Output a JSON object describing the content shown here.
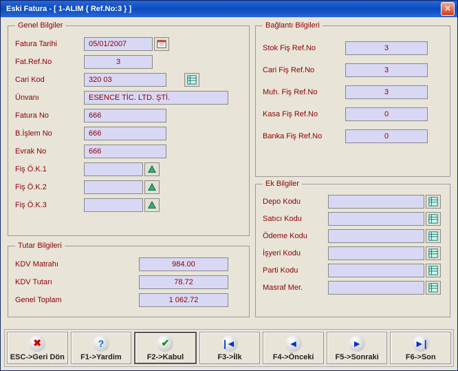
{
  "window": {
    "title": "Eski Fatura - [ 1-ALIM { Ref.No:3 } ]"
  },
  "genel": {
    "legend": "Genel Bilgiler",
    "fatura_tarihi_label": "Fatura Tarihi",
    "fatura_tarihi": "05/01/2007",
    "fat_refno_label": "Fat.Ref.No",
    "fat_refno": "3",
    "cari_kod_label": "Cari Kod",
    "cari_kod": "320 03",
    "unvani_label": "Ünvanı",
    "unvani": "ESENCE TİC. LTD. ŞTİ.",
    "fatura_no_label": "Fatura No",
    "fatura_no": "666",
    "bislem_no_label": "B.İşlem No",
    "bislem_no": "666",
    "evrak_no_label": "Evrak No",
    "evrak_no": "666",
    "fis_ok1_label": "Fiş Ö.K.1",
    "fis_ok1": "",
    "fis_ok2_label": "Fiş Ö.K.2",
    "fis_ok2": "",
    "fis_ok3_label": "Fiş Ö.K.3",
    "fis_ok3": ""
  },
  "baglanti": {
    "legend": "Bağlantı Bilgileri",
    "stok_label": "Stok Fiş Ref.No",
    "stok": "3",
    "cari_label": "Cari Fiş Ref.No",
    "cari": "3",
    "muh_label": "Muh. Fiş Ref.No",
    "muh": "3",
    "kasa_label": "Kasa Fiş Ref.No",
    "kasa": "0",
    "banka_label": "Banka Fiş Ref.No",
    "banka": "0"
  },
  "ek": {
    "legend": "Ek Bilgiler",
    "depo_label": "Depo Kodu",
    "depo": "",
    "satici_label": "Satıcı Kodu",
    "satici": "",
    "odeme_label": "Ödeme Kodu",
    "odeme": "",
    "isyeri_label": "İşyeri Kodu",
    "isyeri": "",
    "parti_label": "Parti Kodu",
    "parti": "",
    "masraf_label": "Masraf Mer.",
    "masraf": ""
  },
  "tutar": {
    "legend": "Tutar Bilgileri",
    "kdv_matrahi_label": "KDV Matrahı",
    "kdv_matrahi": "984.00",
    "kdv_tutari_label": "KDV Tutarı",
    "kdv_tutari": "78.72",
    "genel_toplam_label": "Genel Toplam",
    "genel_toplam": "1 062.72"
  },
  "footer": {
    "esc": "ESC->Geri Dön",
    "f1": "F1->Yardim",
    "f2": "F2->Kabul",
    "f3": "F3->İlk",
    "f4": "F4->Önceki",
    "f5": "F5->Sonraki",
    "f6": "F6->Son"
  }
}
